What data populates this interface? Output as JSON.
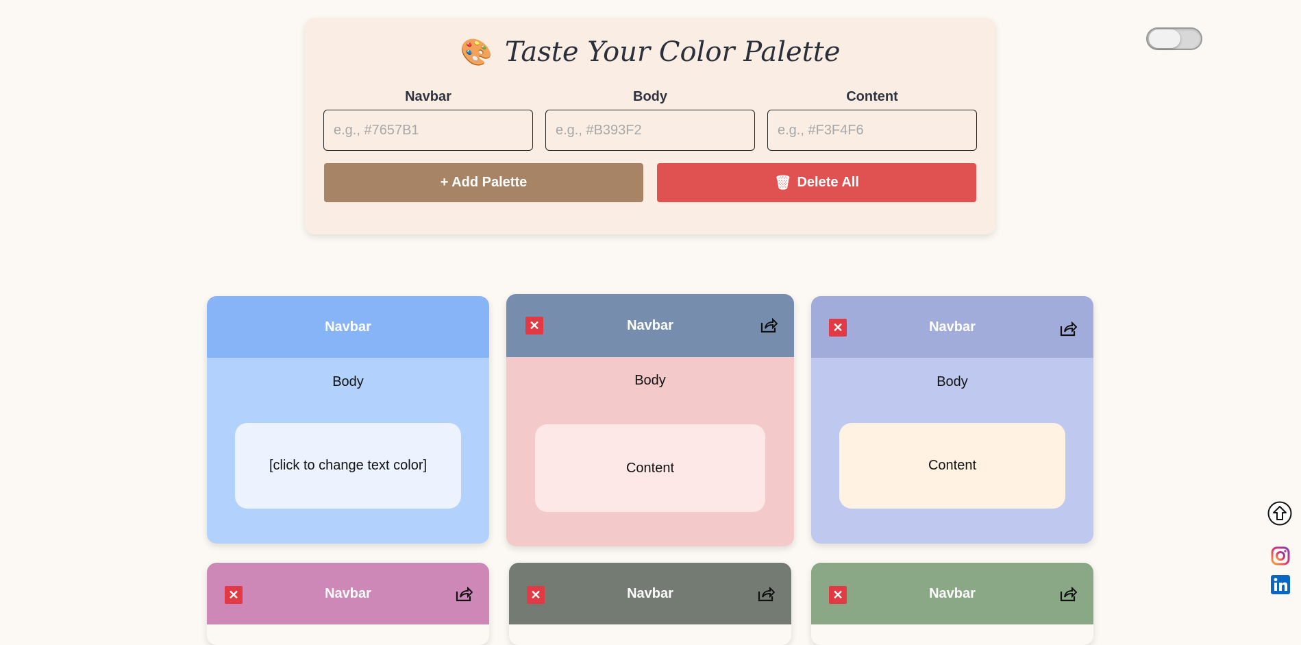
{
  "header": {
    "palette_emoji": "🎨",
    "title": "Taste Your Color Palette"
  },
  "form": {
    "navbar_label": "Navbar",
    "body_label": "Body",
    "content_label": "Content",
    "navbar_placeholder": "e.g., #7657B1",
    "body_placeholder": "e.g., #B393F2",
    "content_placeholder": "e.g., #F3F4F6",
    "add_button": "+ Add Palette",
    "delete_icon": "🗑",
    "delete_button": "Delete All"
  },
  "theme_toggle": {
    "state": "off"
  },
  "cards": [
    {
      "navbar": "Navbar",
      "body": "Body",
      "content": "[click to change text color]",
      "colors": {
        "nav": "#87b4f7",
        "body": "#b3d1fd",
        "content": "#ecf3ff"
      }
    },
    {
      "navbar": "Navbar",
      "body": "Body",
      "content": "Content",
      "colors": {
        "nav": "#768dae",
        "body": "#f3c9ca",
        "content": "#fde8e7"
      }
    },
    {
      "navbar": "Navbar",
      "body": "Body",
      "content": "Content",
      "colors": {
        "nav": "#a1acdb",
        "body": "#bfc8ee",
        "content": "#fff2e2"
      }
    },
    {
      "navbar": "Navbar",
      "colors": {
        "nav": "#cd88b8"
      }
    },
    {
      "navbar": "Navbar",
      "colors": {
        "nav": "#747b72"
      }
    },
    {
      "navbar": "Navbar",
      "colors": {
        "nav": "#8aa885"
      }
    }
  ],
  "side_icons": [
    "scroll-top-icon",
    "instagram-icon",
    "linkedin-icon"
  ]
}
